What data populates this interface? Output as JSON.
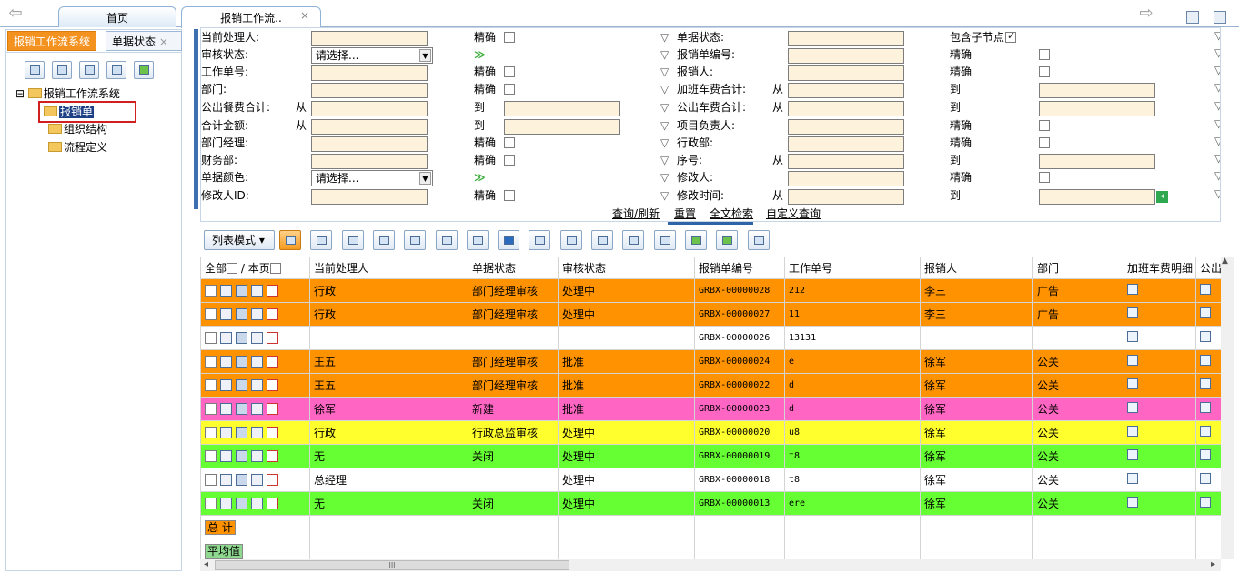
{
  "tabs": [
    {
      "label": "首页"
    },
    {
      "label": "报销工作流..",
      "close": "×"
    }
  ],
  "sidebar": {
    "tabs": [
      {
        "label": "报销工作流系统"
      },
      {
        "label": "单据状态",
        "close": "×"
      }
    ],
    "tree": {
      "root": "报销工作流系统",
      "expander": "⊟",
      "children": [
        "报销单",
        "组织结构",
        "流程定义"
      ]
    }
  },
  "form": {
    "rows": [
      {
        "l1": "当前处理人:",
        "e1": "精确",
        "l2": "单据状态:",
        "e2": "包含子节点"
      },
      {
        "l1": "审核状态:",
        "sel": "请选择...",
        "l2": "报销单编号:",
        "e2": "精确"
      },
      {
        "l1": "工作单号:",
        "e1": "精确",
        "l2": "报销人:",
        "e2": "精确"
      },
      {
        "l1": "部门:",
        "e1": "精确",
        "l2": "加班车费合计:",
        "from2": "从",
        "to2": "到"
      },
      {
        "l1": "公出餐费合计:",
        "from1": "从",
        "to1": "到",
        "l2": "公出车费合计:",
        "from2": "从",
        "to2": "到"
      },
      {
        "l1": "合计金额:",
        "from1": "从",
        "to1": "到",
        "l2": "项目负责人:",
        "e2": "精确"
      },
      {
        "l1": "部门经理:",
        "e1": "精确",
        "l2": "行政部:",
        "e2": "精确"
      },
      {
        "l1": "财务部:",
        "e1": "精确",
        "l2": "序号:",
        "from2": "从",
        "to2": "到"
      },
      {
        "l1": "单据颜色:",
        "sel": "请选择...",
        "l2": "修改人:",
        "e2": "精确"
      },
      {
        "l1": "修改人ID:",
        "e1": "精确",
        "l2": "修改时间:",
        "from2": "从",
        "to2": "到"
      }
    ],
    "buttons": [
      "查询/刷新",
      "重置",
      "全文检索",
      "自定义查询"
    ]
  },
  "toolbar": {
    "list_mode": "列表模式 ▾"
  },
  "grid": {
    "select_all": "全部",
    "page_sep": "/",
    "this_page": "本页",
    "columns": [
      "当前处理人",
      "单据状态",
      "审核状态",
      "报销单编号",
      "工作单号",
      "报销人",
      "部门",
      "加班车费明细",
      "公出"
    ],
    "rows": [
      {
        "handler": "行政",
        "doc": "部门经理审核",
        "audit": "处理中",
        "no": "GRBX-00000028",
        "job": "212",
        "person": "李三",
        "dept": "广告",
        "color": "#ff9200"
      },
      {
        "handler": "行政",
        "doc": "部门经理审核",
        "audit": "处理中",
        "no": "GRBX-00000027",
        "job": "11",
        "person": "李三",
        "dept": "广告",
        "color": "#ff9200"
      },
      {
        "handler": "",
        "doc": "",
        "audit": "",
        "no": "GRBX-00000026",
        "job": "13131",
        "person": "",
        "dept": "",
        "color": "#ffffff"
      },
      {
        "handler": "王五",
        "doc": "部门经理审核",
        "audit": "批准",
        "no": "GRBX-00000024",
        "job": "e",
        "person": "徐军",
        "dept": "公关",
        "color": "#ff9200"
      },
      {
        "handler": "王五",
        "doc": "部门经理审核",
        "audit": "批准",
        "no": "GRBX-00000022",
        "job": "d",
        "person": "徐军",
        "dept": "公关",
        "color": "#ff9200"
      },
      {
        "handler": "徐军",
        "doc": "新建",
        "audit": "批准",
        "no": "GRBX-00000023",
        "job": "d",
        "person": "徐军",
        "dept": "公关",
        "color": "#ff66c4"
      },
      {
        "handler": "行政",
        "doc": "行政总监审核",
        "audit": "处理中",
        "no": "GRBX-00000020",
        "job": "u8",
        "person": "徐军",
        "dept": "公关",
        "color": "#ffff2e"
      },
      {
        "handler": "无",
        "doc": "关闭",
        "audit": "处理中",
        "no": "GRBX-00000019",
        "job": "t8",
        "person": "徐军",
        "dept": "公关",
        "color": "#66ff33"
      },
      {
        "handler": "总经理",
        "doc": "",
        "audit": "处理中",
        "no": "GRBX-00000018",
        "job": "t8",
        "person": "徐军",
        "dept": "公关",
        "color": "#ffffff"
      },
      {
        "handler": "无",
        "doc": "关闭",
        "audit": "处理中",
        "no": "GRBX-00000013",
        "job": "ere",
        "person": "徐军",
        "dept": "公关",
        "color": "#66ff33"
      }
    ],
    "total_label": "总 计",
    "avg_label": "平均值"
  },
  "scroll": {
    "thumb": "III",
    "left": "◂",
    "right": "▸"
  }
}
